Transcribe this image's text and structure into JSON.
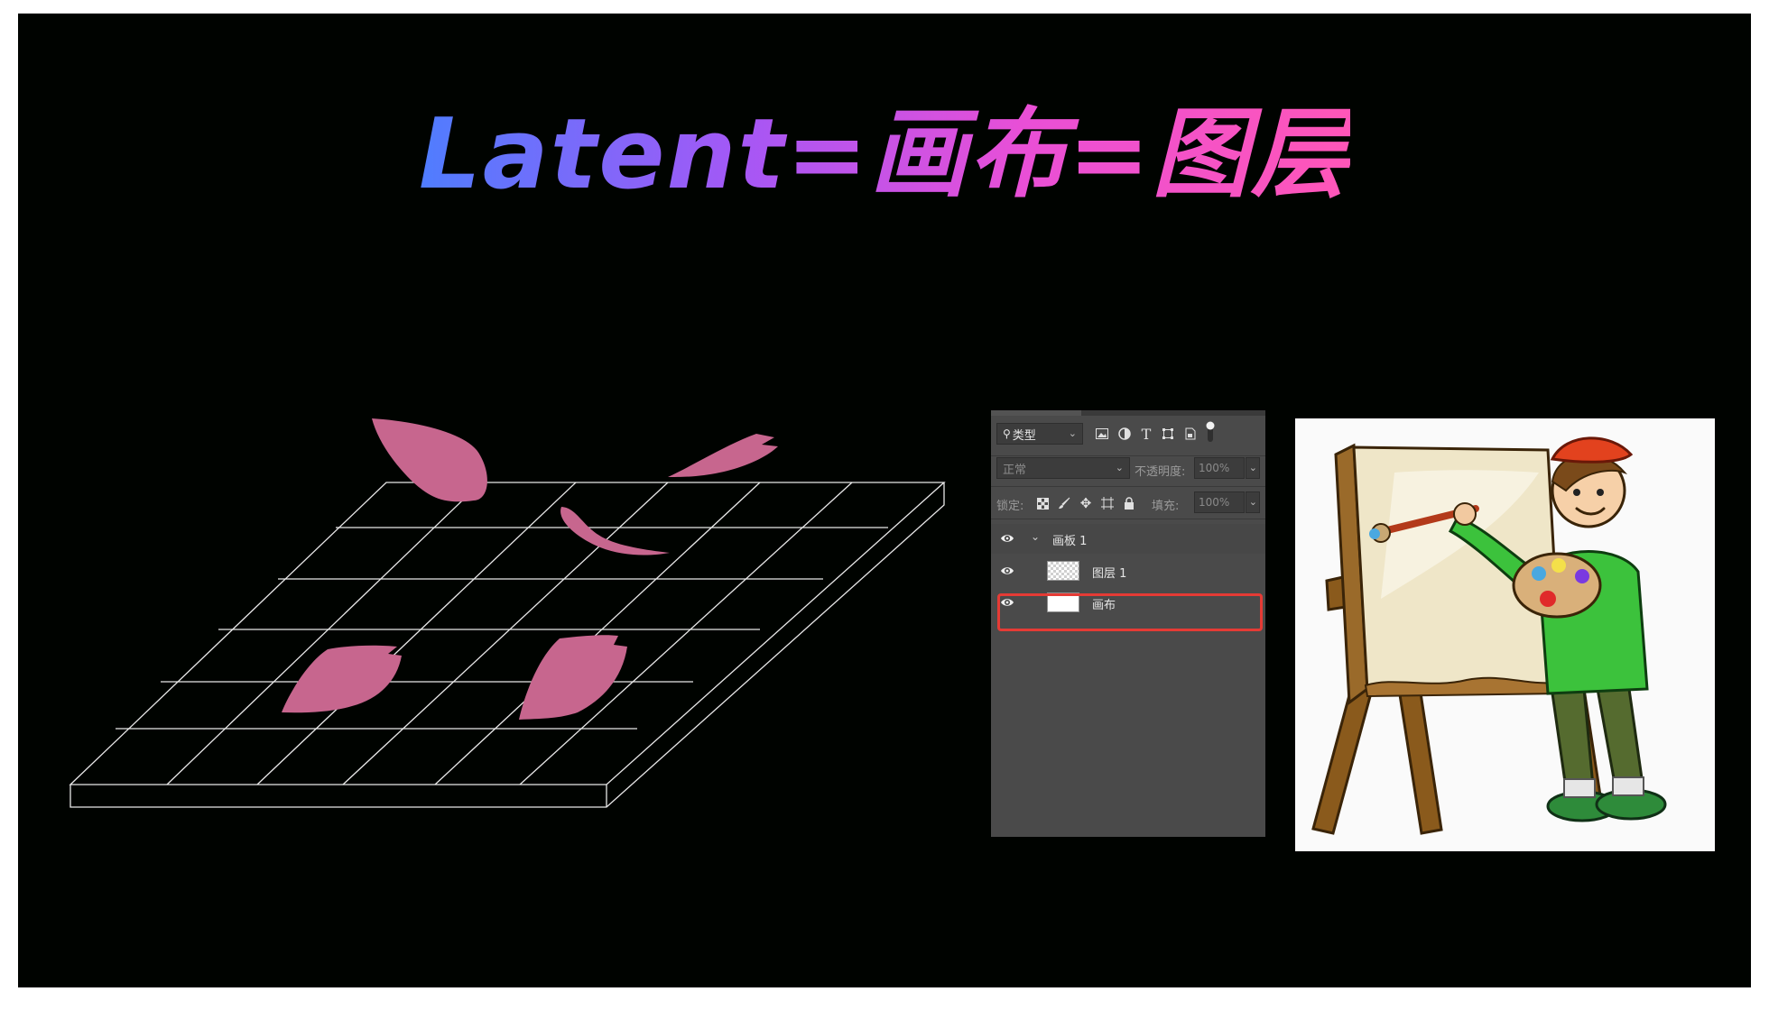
{
  "slide": {
    "title": "Latent=画布=图层"
  },
  "layers_panel": {
    "filter_select": "类型",
    "blend_mode": "正常",
    "opacity_label": "不透明度:",
    "opacity_value": "100%",
    "lock_label": "锁定:",
    "fill_label": "填充:",
    "fill_value": "100%",
    "group_name": "画板 1",
    "layers": [
      {
        "name": "图层 1",
        "thumbnail": "transparent-checker"
      },
      {
        "name": "画布",
        "thumbnail": "white",
        "selected_outline_color": "#e53b35"
      }
    ],
    "filter_icons": [
      "image-icon",
      "adjustment-icon",
      "type-icon",
      "shape-icon",
      "smart-object-icon",
      "toggle-icon"
    ],
    "lock_icons": [
      "lock-transparent-icon",
      "lock-brush-icon",
      "move-icon",
      "artboard-icon",
      "lock-icon"
    ]
  },
  "colors": {
    "background": "#000300",
    "petal": "#c7668e",
    "grid_line": "#e8e8e8",
    "title_gradient": [
      "#4f7dff",
      "#a657f5",
      "#e94fd6",
      "#ff56b8"
    ],
    "panel_bg": "#4a4a4a"
  }
}
